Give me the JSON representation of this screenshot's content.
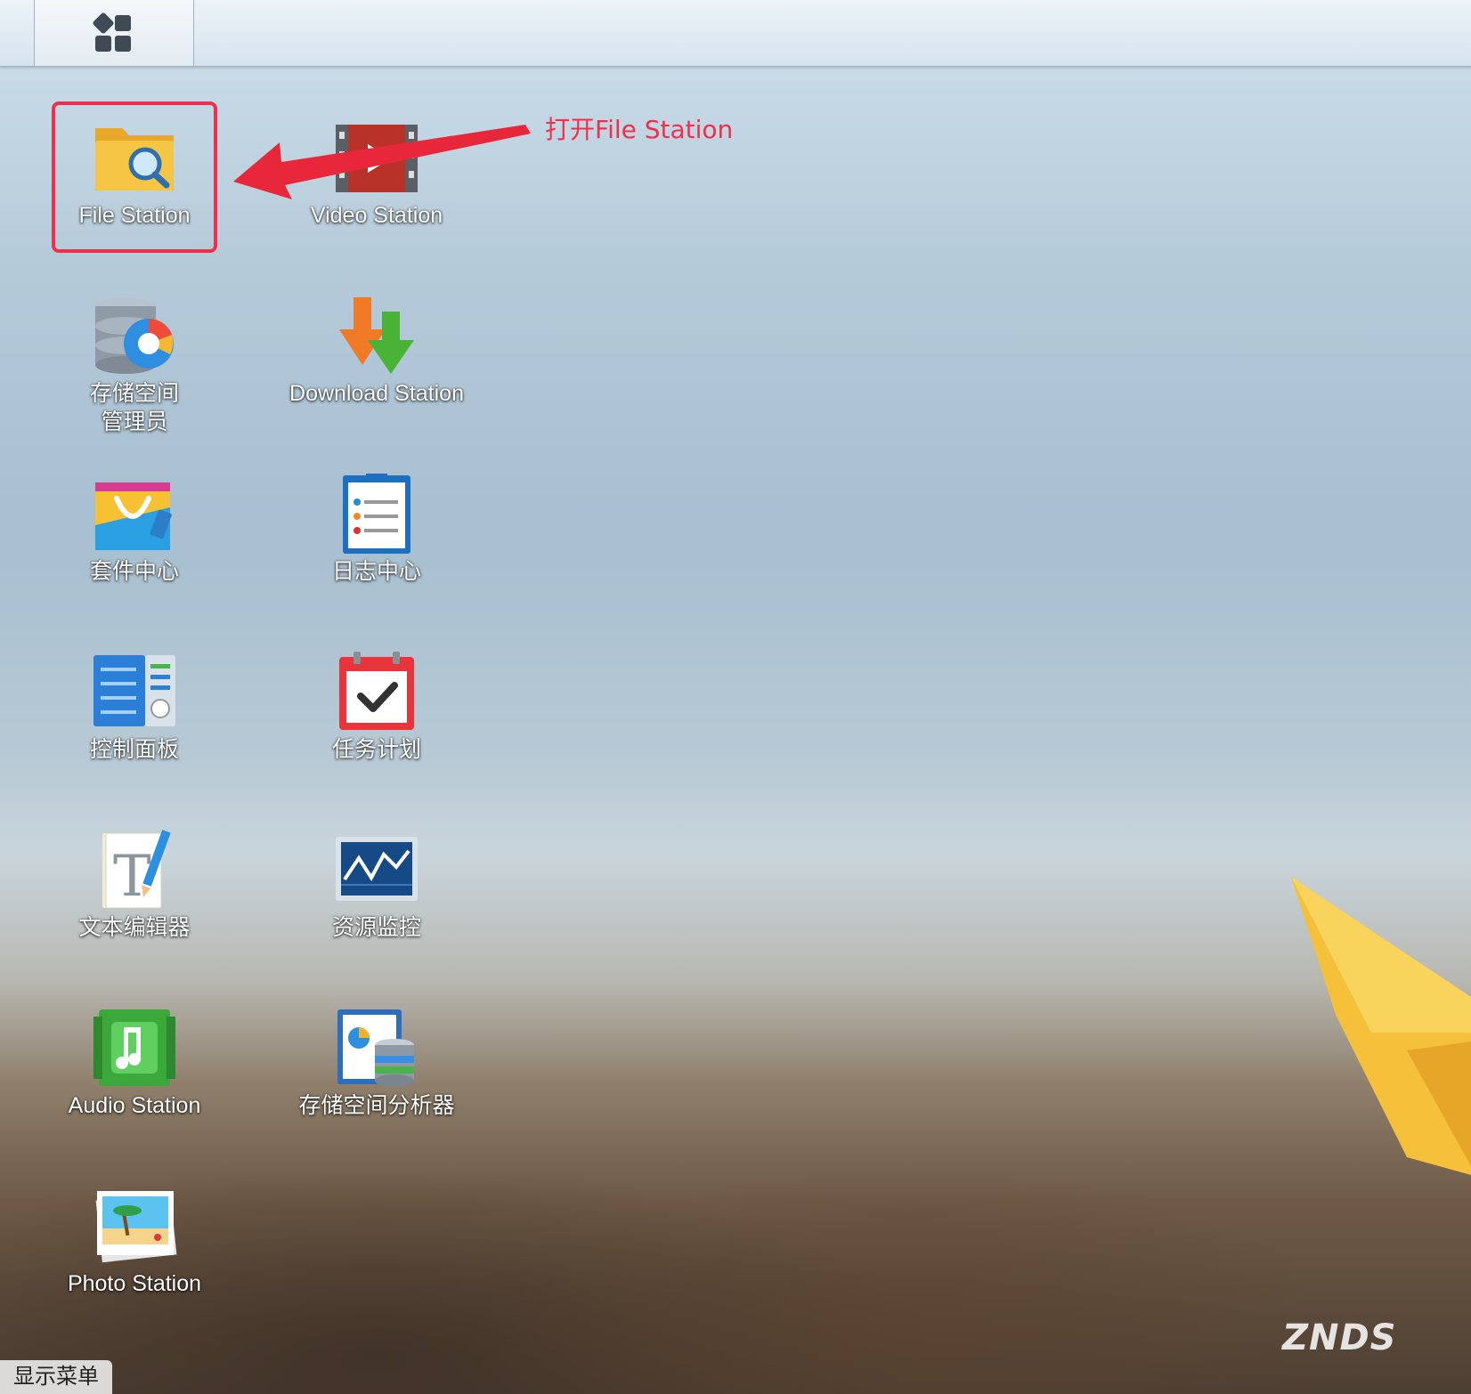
{
  "desktop": {
    "apps": [
      {
        "label": "File Station"
      },
      {
        "label": "Video Station"
      },
      {
        "label": "存储空间\n管理员"
      },
      {
        "label": "Download Station"
      },
      {
        "label": "套件中心"
      },
      {
        "label": "日志中心"
      },
      {
        "label": "控制面板"
      },
      {
        "label": "任务计划"
      },
      {
        "label": "文本编辑器"
      },
      {
        "label": "资源监控"
      },
      {
        "label": "Audio Station"
      },
      {
        "label": "存储空间分析器"
      },
      {
        "label": "Photo Station"
      }
    ]
  },
  "annotation": {
    "text": "打开File Station",
    "color": "#f0304a"
  },
  "taskbar": {
    "show_menu_label": "显示菜单"
  },
  "watermark": {
    "text": "ZNDS"
  }
}
